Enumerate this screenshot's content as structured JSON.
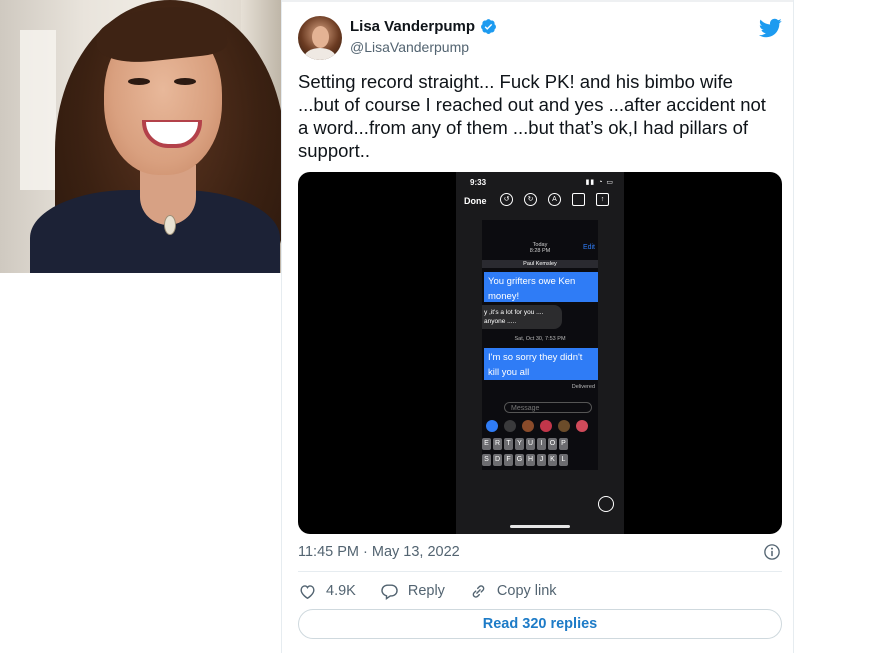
{
  "tweet": {
    "author_name": "Lisa Vanderpump",
    "handle": "@LisaVanderpump",
    "text": "Setting record straight... Fuck PK! and his bimbo wife ...but of course I reached  out and yes ...after accident not a word...from any of them ...but that’s ok,I had pillars of support..",
    "timestamp": "11:45 PM · May 13, 2022",
    "likes": "4.9K",
    "reply_label": "Reply",
    "copy_link_label": "Copy link",
    "read_replies_label": "Read 320 replies"
  },
  "screenshot_media": {
    "status_time": "9:33",
    "done_label": "Done",
    "today_label": "Today",
    "today_time": "8:28 PM",
    "edit_label": "Edit",
    "contact_name": "Paul Kemsley",
    "message_1": "You grifters owe Ken money!",
    "message_gray": "y ,it's a lot for you .... anyone .....",
    "date_2": "Sat, Oct 30, 7:53 PM",
    "message_2": "I'm so sorry they didn't kill you all",
    "delivered_label": "Delivered",
    "message_placeholder": "Message",
    "keyboard_row_1": [
      "E",
      "R",
      "T",
      "Y",
      "U",
      "I",
      "O",
      "P"
    ],
    "keyboard_row_2": [
      "S",
      "D",
      "F",
      "G",
      "H",
      "J",
      "K",
      "L"
    ]
  },
  "colors": {
    "verified_blue": "#1d9bf0",
    "twitter_blue": "#1d9bf0",
    "link_blue": "#1d7bc7",
    "imessage_blue": "#2f7cf6",
    "muted_text": "#536471"
  },
  "icons": [
    "verified-icon",
    "twitter-bird-icon",
    "info-icon",
    "heart-icon",
    "reply-icon",
    "link-icon"
  ]
}
